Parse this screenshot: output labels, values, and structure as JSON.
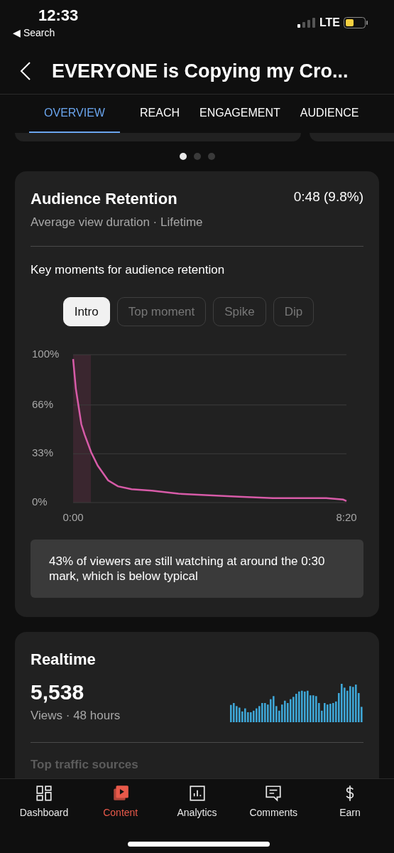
{
  "status_bar": {
    "time": "12:33",
    "back_label": "◀ Search",
    "network": "LTE"
  },
  "header": {
    "title": "EVERYONE is Copying my Cro..."
  },
  "tabs": [
    {
      "label": "OVERVIEW",
      "selected": true
    },
    {
      "label": "REACH",
      "selected": false
    },
    {
      "label": "ENGAGEMENT",
      "selected": false
    },
    {
      "label": "AUDIENCE",
      "selected": false
    }
  ],
  "page_dots": [
    {
      "selected": true
    },
    {
      "selected": false
    },
    {
      "selected": false
    }
  ],
  "retention_card": {
    "title": "Audience Retention",
    "value": "0:48 (9.8%)",
    "subtitle": "Average view duration · Lifetime",
    "key_moments_label": "Key moments for audience retention",
    "chips": [
      {
        "label": "Intro",
        "selected": true
      },
      {
        "label": "Top moment",
        "selected": false
      },
      {
        "label": "Spike",
        "selected": false
      },
      {
        "label": "Dip",
        "selected": false
      }
    ],
    "chart_data": {
      "type": "line",
      "x": [
        0,
        5,
        15,
        21,
        33,
        45,
        64,
        82,
        107,
        144,
        193,
        242,
        303,
        365,
        463,
        494,
        500
      ],
      "series": [
        {
          "color": "#d75ba8",
          "values": [
            97,
            77,
            53,
            46,
            34,
            25,
            15,
            11,
            9,
            8,
            6,
            5,
            4,
            3,
            3,
            2,
            1
          ]
        }
      ],
      "xlim": [
        0,
        500
      ],
      "ylim": [
        0,
        100
      ],
      "xticks": [
        {
          "value": 0,
          "label": "0:00"
        },
        {
          "value": 500,
          "label": "8:20"
        }
      ],
      "yticks": [
        {
          "value": 0,
          "label": "0%"
        },
        {
          "value": 33,
          "label": "33%"
        },
        {
          "value": 66,
          "label": "66%"
        },
        {
          "value": 100,
          "label": "100%"
        }
      ]
    },
    "insight": "43% of viewers are still watching at around the 0:30 mark, which is below typical"
  },
  "realtime_card": {
    "title": "Realtime",
    "views": "5,538",
    "subtitle": "Views · 48 hours",
    "next_section": "Top traffic sources"
  },
  "bottom_nav": [
    {
      "kind": "dashboard",
      "label": "Dashboard",
      "selected": false
    },
    {
      "kind": "content",
      "label": "Content",
      "selected": true
    },
    {
      "kind": "analytics",
      "label": "Analytics",
      "selected": false
    },
    {
      "kind": "comments",
      "label": "Comments",
      "selected": false
    },
    {
      "kind": "earn",
      "label": "Earn",
      "selected": false
    }
  ]
}
